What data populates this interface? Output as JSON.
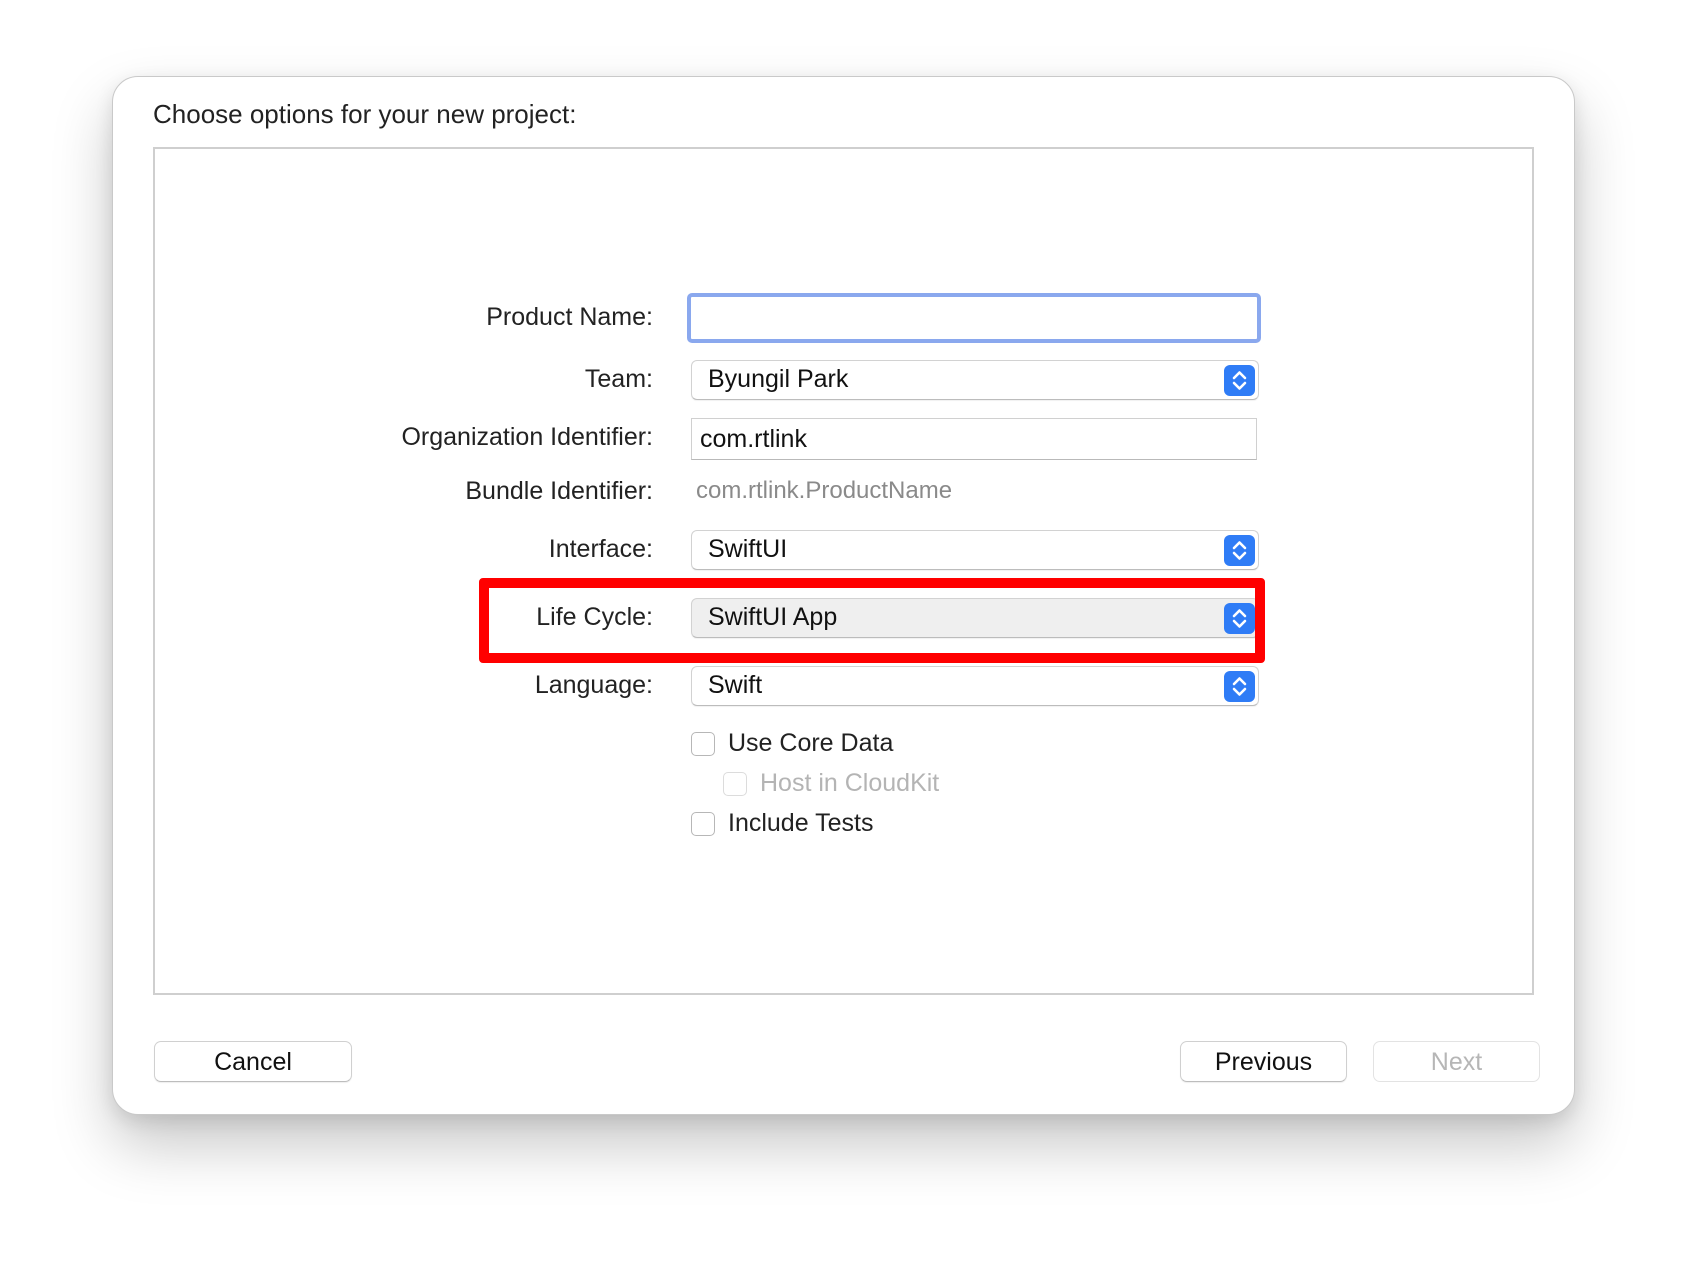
{
  "dialog": {
    "title": "Choose options for your new project:"
  },
  "form": {
    "product_name": {
      "label": "Product Name:",
      "value": ""
    },
    "team": {
      "label": "Team:",
      "value": "Byungil Park"
    },
    "organization_identifier": {
      "label": "Organization Identifier:",
      "value": "com.rtlink"
    },
    "bundle_identifier": {
      "label": "Bundle Identifier:",
      "value": "com.rtlink.ProductName"
    },
    "interface": {
      "label": "Interface:",
      "value": "SwiftUI"
    },
    "life_cycle": {
      "label": "Life Cycle:",
      "value": "SwiftUI App"
    },
    "language": {
      "label": "Language:",
      "value": "Swift"
    },
    "use_core_data": {
      "label": "Use Core Data",
      "checked": false
    },
    "host_in_cloudkit": {
      "label": "Host in CloudKit",
      "checked": false,
      "enabled": false
    },
    "include_tests": {
      "label": "Include Tests",
      "checked": false
    }
  },
  "footer": {
    "cancel_label": "Cancel",
    "previous_label": "Previous",
    "next_label": "Next"
  },
  "colors": {
    "accent": "#2f7cf6",
    "focus_ring": "#8aa8ee",
    "highlight": "#ff0000"
  },
  "icons": {
    "popup_stepper": "chevron-up-down-icon"
  }
}
